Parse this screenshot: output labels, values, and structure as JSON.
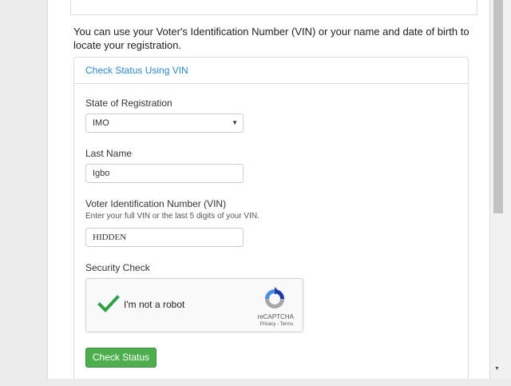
{
  "intro": "You can use your Voter's Identification Number (VIN) or your name and date of birth to locate your registration.",
  "panel": {
    "title": "Check Status Using VIN"
  },
  "form": {
    "state_label": "State of Registration",
    "state_value": "IMO",
    "lastname_label": "Last Name",
    "lastname_value": "Igbo",
    "vin_label": "Voter Identification Number (VIN)",
    "vin_help": "Enter your full VIN or the last 5 digits of your VIN.",
    "vin_value": "HIDDEN",
    "security_label": "Security Check",
    "submit_label": "Check Status"
  },
  "captcha": {
    "label": "I'm not a robot",
    "brand": "reCAPTCHA",
    "links": "Privacy - Terms",
    "checked": true
  },
  "colors": {
    "link_blue": "#2a87c8",
    "button_green": "#4cae4c",
    "check_green": "#2e9f43"
  },
  "icons": {
    "select_caret": "▼",
    "scroll_down": "▼"
  }
}
